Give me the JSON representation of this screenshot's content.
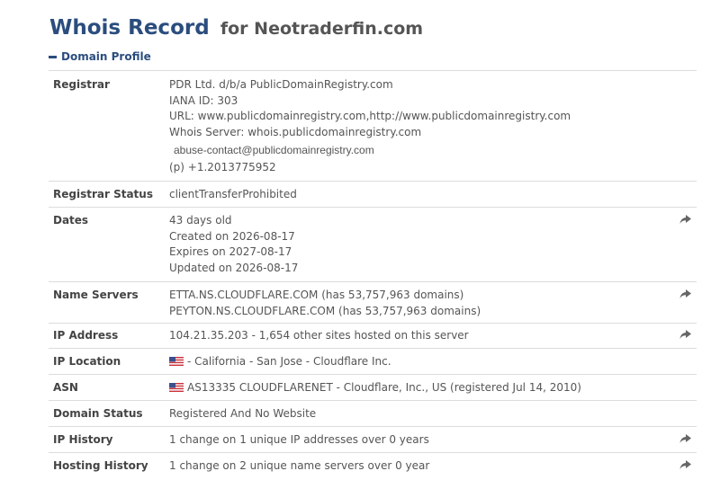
{
  "header": {
    "title": "Whois Record",
    "domain_suffix": "for Neotraderfin.com"
  },
  "section": {
    "toggle_label": "Domain Profile"
  },
  "records": {
    "registrar": {
      "label": "Registrar",
      "lines": [
        "PDR Ltd. d/b/a PublicDomainRegistry.com",
        "IANA ID: 303",
        "URL: www.publicdomainregistry.com,http://www.publicdomainregistry.com",
        "Whois Server: whois.publicdomainregistry.com",
        "abuse-contact@publicdomainregistry.com",
        "(p) +1.2013775952"
      ]
    },
    "registrar_status": {
      "label": "Registrar Status",
      "value": "clientTransferProhibited"
    },
    "dates": {
      "label": "Dates",
      "lines": [
        "43 days old",
        "Created on 2026-08-17",
        "Expires on 2027-08-17",
        "Updated on 2026-08-17"
      ]
    },
    "name_servers": {
      "label": "Name Servers",
      "lines": [
        "ETTA.NS.CLOUDFLARE.COM (has 53,757,963 domains)",
        "PEYTON.NS.CLOUDFLARE.COM (has 53,757,963 domains)"
      ]
    },
    "ip_address": {
      "label": "IP Address",
      "value": "104.21.35.203 - 1,654 other sites hosted on this server"
    },
    "ip_location": {
      "label": "IP Location",
      "value": "- California - San Jose - Cloudflare Inc."
    },
    "asn": {
      "label": "ASN",
      "value": "AS13335 CLOUDFLARENET - Cloudflare, Inc., US (registered Jul 14, 2010)"
    },
    "domain_status": {
      "label": "Domain Status",
      "value": "Registered And No Website"
    },
    "ip_history": {
      "label": "IP History",
      "value": "1 change on 1 unique IP addresses over 0 years"
    },
    "hosting_history": {
      "label": "Hosting History",
      "value": "1 change on 2 unique name servers over 0 year"
    }
  },
  "icons": {
    "share": "share-arrow-icon",
    "flag": "us-flag-icon"
  },
  "colors": {
    "accent": "#2b4d7e",
    "border": "#dcdcdc",
    "text": "#555555"
  }
}
